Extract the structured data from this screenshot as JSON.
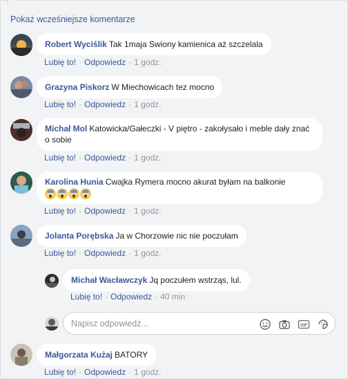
{
  "header": {
    "more_comments": "Pokaż wcześniejsze komentarze"
  },
  "actions": {
    "like": "Lubię to!",
    "reply": "Odpowiedz",
    "sep": "·"
  },
  "comments": [
    {
      "author": "Robert Wyciślik",
      "text": "Tak 1maja Swiony kamienica aż szczelala",
      "time": "1 godz."
    },
    {
      "author": "Grazyna Piskorz",
      "text": "W Miechowicach tez mocno",
      "time": "1 godz."
    },
    {
      "author": "Michał Mol",
      "text": "Katowicka/Gałeczki - V piętro - zakołysało i meble dały znać o sobie",
      "time": "1 godz."
    },
    {
      "author": "Karolina Hunia",
      "text": "Cwajka Rymera mocno akurat byłam na balkonie",
      "emoji_count": 4,
      "emoji": "screaming-face-emoji",
      "time": "1 godz."
    },
    {
      "author": "Jolanta Porębska",
      "text": "Ja w Chorzowie nic nie poczułam",
      "time": "1 godz."
    },
    {
      "author": "Michał Wacławczyk",
      "text": "Jq poczułem wstrząs, lul.",
      "time": "40 min"
    },
    {
      "author": "Małgorzata Kużaj",
      "text": "BATORY",
      "time": "1 godz."
    }
  ],
  "reply_box": {
    "placeholder": "Napisz odpowiedź...",
    "icons": [
      "smiley-icon",
      "camera-icon",
      "gif-icon",
      "sticker-icon"
    ]
  },
  "colors": {
    "link": "#385898",
    "background": "#f2f3f5",
    "bubble": "#ffffff",
    "meta": "#90949c"
  }
}
